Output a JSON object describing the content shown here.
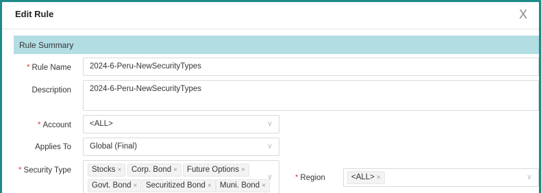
{
  "dialog": {
    "title": "Edit Rule",
    "close_glyph": "X"
  },
  "section": {
    "title": "Rule Summary"
  },
  "form": {
    "rule_name": {
      "label": "Rule Name",
      "required": "*",
      "value": "2024-6-Peru-NewSecurityTypes"
    },
    "description": {
      "label": "Description",
      "value": "2024-6-Peru-NewSecurityTypes"
    },
    "account": {
      "label": "Account",
      "required": "*",
      "value": "<ALL>"
    },
    "applies_to": {
      "label": "Applies To",
      "value": "Global (Final)"
    },
    "security_type": {
      "label": "Security Type",
      "required": "*",
      "tags": [
        "Stocks",
        "Corp. Bond",
        "Future Options",
        "Govt. Bond",
        "Securitized Bond",
        "Muni. Bond"
      ]
    },
    "region": {
      "label": "Region",
      "required": "*",
      "tags": [
        "<ALL>"
      ]
    }
  },
  "icons": {
    "tag_remove": "×",
    "chevron": "∨"
  },
  "colors": {
    "section_bg": "#b2dde3",
    "border_accent": "#1e8a8a",
    "required": "#e03c3c"
  }
}
